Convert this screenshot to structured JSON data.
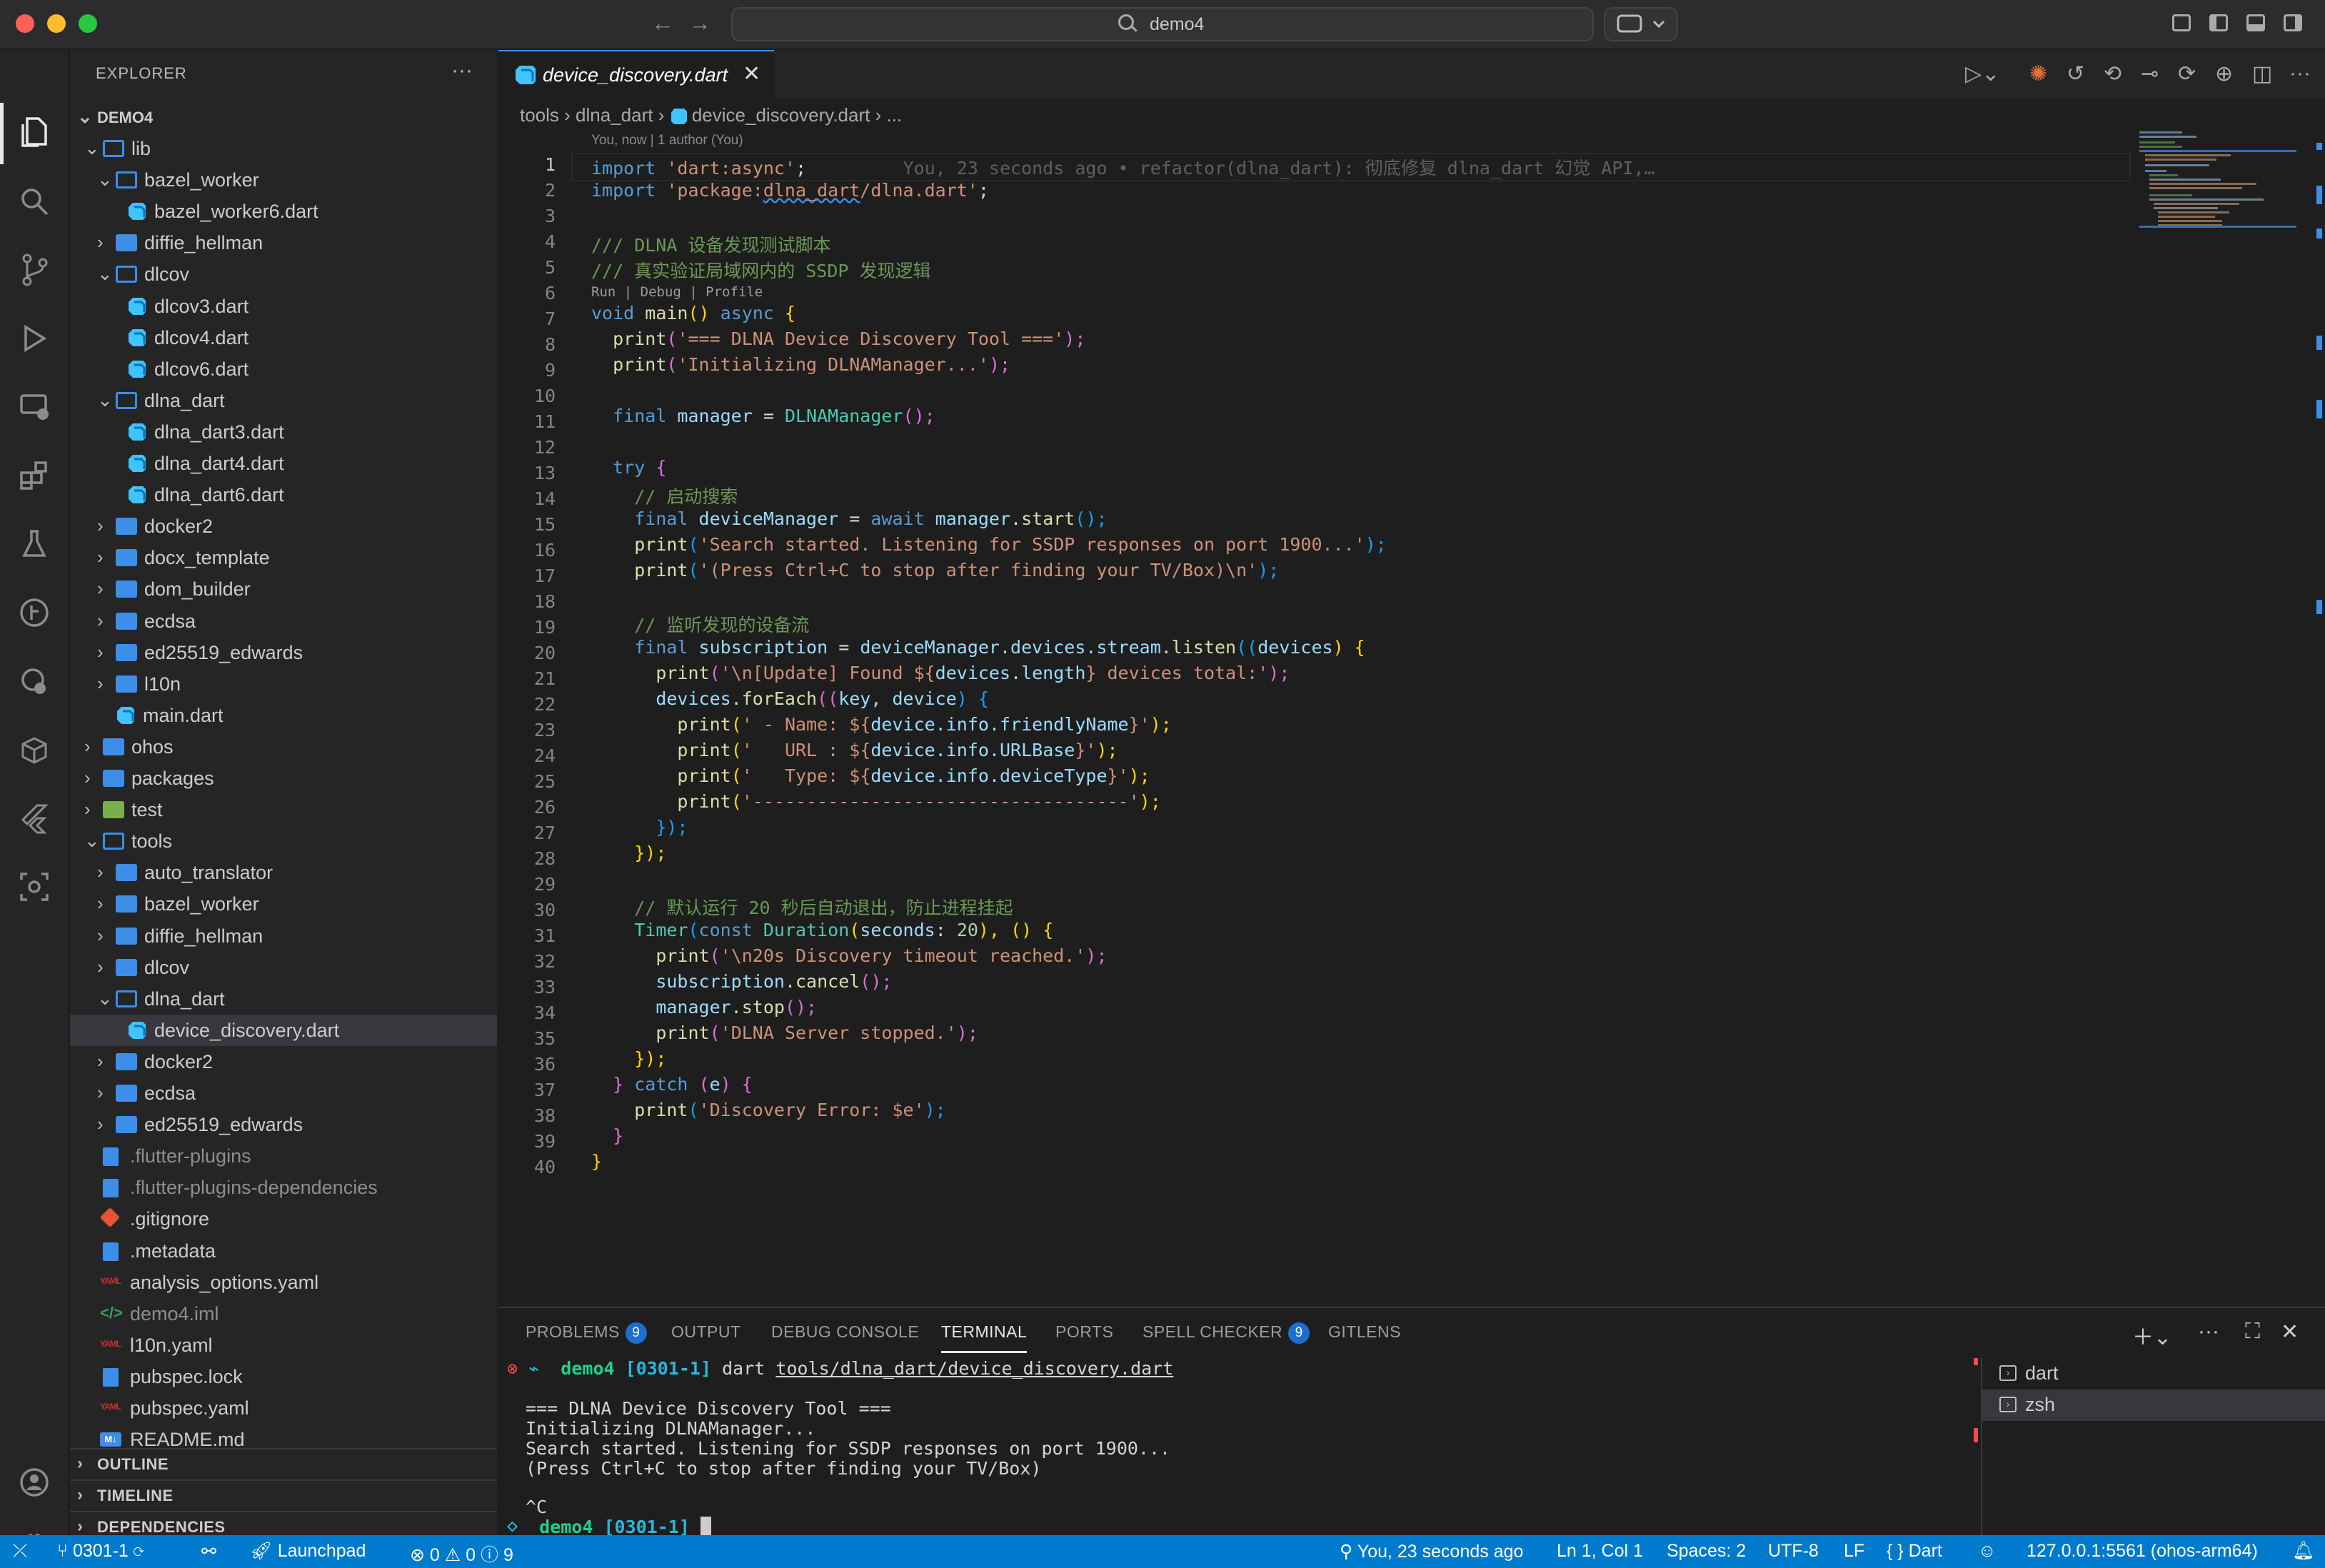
{
  "titlebar": {
    "search_text": "demo4"
  },
  "colors": {
    "accent": "#007acc",
    "folder": "#3c8ee8",
    "dart": "#40c4ff"
  },
  "explorer": {
    "title": "EXPLORER",
    "workspace": "DEMO4",
    "rows": [
      {
        "label": "lib",
        "type": "folder",
        "open": true,
        "depth": 1
      },
      {
        "label": "bazel_worker",
        "type": "folder",
        "open": true,
        "depth": 2
      },
      {
        "label": "bazel_worker6.dart",
        "type": "dart",
        "depth": 3
      },
      {
        "label": "diffie_hellman",
        "type": "folder",
        "open": false,
        "depth": 2
      },
      {
        "label": "dlcov",
        "type": "folder",
        "open": true,
        "depth": 2
      },
      {
        "label": "dlcov3.dart",
        "type": "dart",
        "depth": 3
      },
      {
        "label": "dlcov4.dart",
        "type": "dart",
        "depth": 3
      },
      {
        "label": "dlcov6.dart",
        "type": "dart",
        "depth": 3
      },
      {
        "label": "dlna_dart",
        "type": "folder",
        "open": true,
        "depth": 2
      },
      {
        "label": "dlna_dart3.dart",
        "type": "dart",
        "depth": 3
      },
      {
        "label": "dlna_dart4.dart",
        "type": "dart",
        "depth": 3
      },
      {
        "label": "dlna_dart6.dart",
        "type": "dart",
        "depth": 3
      },
      {
        "label": "docker2",
        "type": "folder",
        "open": false,
        "depth": 2
      },
      {
        "label": "docx_template",
        "type": "folder",
        "open": false,
        "depth": 2
      },
      {
        "label": "dom_builder",
        "type": "folder",
        "open": false,
        "depth": 2
      },
      {
        "label": "ecdsa",
        "type": "folder",
        "open": false,
        "depth": 2
      },
      {
        "label": "ed25519_edwards",
        "type": "folder",
        "open": false,
        "depth": 2
      },
      {
        "label": "l10n",
        "type": "folder",
        "open": false,
        "depth": 2
      },
      {
        "label": "main.dart",
        "type": "dart",
        "depth": 2
      },
      {
        "label": "ohos",
        "type": "folder",
        "open": false,
        "depth": 1
      },
      {
        "label": "packages",
        "type": "folder",
        "open": false,
        "depth": 1
      },
      {
        "label": "test",
        "type": "test",
        "open": false,
        "depth": 1
      },
      {
        "label": "tools",
        "type": "folder",
        "open": true,
        "depth": 1
      },
      {
        "label": "auto_translator",
        "type": "folder",
        "open": false,
        "depth": 2
      },
      {
        "label": "bazel_worker",
        "type": "folder",
        "open": false,
        "depth": 2
      },
      {
        "label": "diffie_hellman",
        "type": "folder",
        "open": false,
        "depth": 2
      },
      {
        "label": "dlcov",
        "type": "folder",
        "open": false,
        "depth": 2
      },
      {
        "label": "dlna_dart",
        "type": "folder",
        "open": true,
        "depth": 2
      },
      {
        "label": "device_discovery.dart",
        "type": "dart",
        "depth": 3,
        "selected": true
      },
      {
        "label": "docker2",
        "type": "folder",
        "open": false,
        "depth": 2
      },
      {
        "label": "ecdsa",
        "type": "folder",
        "open": false,
        "depth": 2
      },
      {
        "label": "ed25519_edwards",
        "type": "folder",
        "open": false,
        "depth": 2
      },
      {
        "label": ".flutter-plugins",
        "type": "file",
        "depth": 1,
        "dim": true
      },
      {
        "label": ".flutter-plugins-dependencies",
        "type": "file",
        "depth": 1,
        "dim": true
      },
      {
        "label": ".gitignore",
        "type": "git",
        "depth": 1
      },
      {
        "label": ".metadata",
        "type": "file",
        "depth": 1
      },
      {
        "label": "analysis_options.yaml",
        "type": "yaml",
        "depth": 1
      },
      {
        "label": "demo4.iml",
        "type": "xml",
        "depth": 1,
        "dim": true
      },
      {
        "label": "l10n.yaml",
        "type": "yaml",
        "depth": 1
      },
      {
        "label": "pubspec.lock",
        "type": "file",
        "depth": 1
      },
      {
        "label": "pubspec.yaml",
        "type": "yaml",
        "depth": 1
      },
      {
        "label": "README.md",
        "type": "md",
        "depth": 1
      }
    ],
    "sections": [
      "OUTLINE",
      "TIMELINE",
      "DEPENDENCIES"
    ]
  },
  "editor": {
    "tab_label": "device_discovery.dart",
    "breadcrumb": {
      "part1": "tools",
      "part2": "dlna_dart",
      "part3": "device_discovery.dart",
      "part4": "..."
    },
    "blame_header": "You, now | 1 author (You)",
    "codelens": "Run | Debug | Profile",
    "blame_inline": "You, 23 seconds ago • refactor(dlna_dart): 彻底修复 dlna_dart 幻觉 API,…",
    "line_count": 40,
    "lines": {
      "l1a": "import",
      "l1b": " 'dart:async'",
      "l1c": ";",
      "l2a": "import",
      "l2b": " 'package:",
      "l2c": "dlna_dart",
      "l2d": "/dlna.dart'",
      "l2e": ";",
      "l4": "/// DLNA 设备发现测试脚本",
      "l5": "/// 真实验证局域网内的 SSDP 发现逻辑",
      "l6a": "void",
      "l6b": " main",
      "l6c": "()",
      "l6d": " async",
      "l6e": " {",
      "l7a": "print",
      "l7b": "(",
      "l7c": "'=== DLNA Device Discovery Tool ==='",
      "l7d": ");",
      "l8a": "print",
      "l8b": "(",
      "l8c": "'Initializing DLNAManager...'",
      "l8d": ");",
      "l10a": "final",
      "l10b": " manager",
      "l10c": " = ",
      "l10d": "DLNAManager",
      "l10e": "();",
      "l12a": "try",
      "l12b": " {",
      "l13": "// 启动搜索",
      "l14a": "final",
      "l14b": " deviceManager",
      "l14c": " = ",
      "l14d": "await",
      "l14e": " manager",
      "l14f": ".start",
      "l14g": "();",
      "l15a": "print",
      "l15b": "(",
      "l15c": "'Search started. Listening for SSDP responses on port 1900...'",
      "l15d": ");",
      "l16a": "print",
      "l16b": "(",
      "l16c": "'(Press Ctrl+C to stop after finding your TV/Box)\\n'",
      "l16d": ");",
      "l18": "// 监听发现的设备流",
      "l19a": "final",
      "l19b": " subscription",
      "l19c": " = ",
      "l19d": "deviceManager.devices.stream",
      "l19e": ".listen",
      "l19f": "((",
      "l19g": "devices",
      "l19h": ") {",
      "l20a": "print",
      "l20b": "(",
      "l20c": "'\\n[Update] Found ${",
      "l20d": "devices.length",
      "l20e": "} devices total:'",
      "l20f": ");",
      "l21a": "devices",
      "l21b": ".forEach",
      "l21c": "((",
      "l21d": "key, device",
      "l21e": ") {",
      "l22a": "print",
      "l22b": "(",
      "l22c": "' - Name: ${",
      "l22d": "device.info.friendlyName",
      "l22e": "}'",
      "l22f": ");",
      "l23a": "print",
      "l23b": "(",
      "l23c": "'   URL : ${",
      "l23d": "device.info.URLBase",
      "l23e": "}'",
      "l23f": ");",
      "l24a": "print",
      "l24b": "(",
      "l24c": "'   Type: ${",
      "l24d": "device.info.deviceType",
      "l24e": "}'",
      "l24f": ");",
      "l25a": "print",
      "l25b": "(",
      "l25c": "'-----------------------------------'",
      "l25d": ");",
      "l26": "});",
      "l27": "});",
      "l29": "// 默认运行 20 秒后自动退出，防止进程挂起",
      "l30a": "Timer",
      "l30b": "(",
      "l30c": "const",
      "l30d": " Duration",
      "l30e": "(",
      "l30f": "seconds",
      "l30g": ": ",
      "l30h": "20",
      "l30i": "), () {",
      "l31a": "print",
      "l31b": "(",
      "l31c": "'\\n20s Discovery timeout reached.'",
      "l31d": ");",
      "l32a": "subscription",
      "l32b": ".cancel",
      "l32c": "();",
      "l33a": "manager",
      "l33b": ".stop",
      "l33c": "();",
      "l34a": "print",
      "l34b": "(",
      "l34c": "'DLNA Server stopped.'",
      "l34d": ");",
      "l35": "});",
      "l36a": "}",
      "l36b": " catch",
      "l36c": " (",
      "l36d": "e",
      "l36e": ") {",
      "l37a": "print",
      "l37b": "(",
      "l37c": "'Discovery Error: $e'",
      "l37d": ");",
      "l38": "}",
      "l39": "}"
    }
  },
  "panel": {
    "tabs": {
      "problems": "PROBLEMS",
      "problems_count": "9",
      "output": "OUTPUT",
      "debug": "DEBUG CONSOLE",
      "terminal": "TERMINAL",
      "ports": "PORTS",
      "spell": "SPELL CHECKER",
      "spell_count": "9",
      "gitlens": "GITLENS"
    },
    "terminal": {
      "prompt_dir": "demo4",
      "prompt_branch": "[0301-1]",
      "cmd_a": "dart",
      "cmd_b": "tools/dlna_dart/device_discovery.dart",
      "out1": "=== DLNA Device Discovery Tool ===",
      "out2": "Initializing DLNAManager...",
      "out3": "Search started. Listening for SSDP responses on port 1900...",
      "out4": "(Press Ctrl+C to stop after finding your TV/Box)",
      "out5": "^C",
      "prompt2_dir": "demo4",
      "prompt2_branch": "[0301-1]"
    },
    "terminals": [
      "dart",
      "zsh"
    ]
  },
  "statusbar": {
    "branch": "0301-1",
    "launchpad": "Launchpad",
    "errors": "0",
    "warnings": "0",
    "infos": "9",
    "blame": "You, 23 seconds ago",
    "position": "Ln 1, Col 1",
    "spaces": "Spaces: 2",
    "encoding": "UTF-8",
    "eol": "LF",
    "language": "Dart",
    "device": "127.0.0.1:5561 (ohos-arm64)"
  }
}
